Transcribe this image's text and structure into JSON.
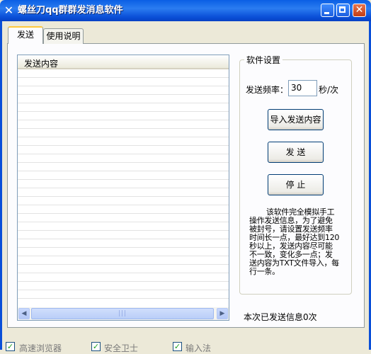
{
  "window": {
    "title": "螺丝刀qq群群发消息软件",
    "icon": "screwdriver-icon",
    "close_glyph": "✕"
  },
  "tabs": [
    {
      "label": "发送"
    },
    {
      "label": "使用说明"
    }
  ],
  "list": {
    "header": "发送内容"
  },
  "settings": {
    "group_title": "软件设置",
    "freq_label": "发送频率：",
    "freq_value": "30",
    "freq_unit": "秒/次",
    "import_label": "导入发送内容",
    "send_label": "发 送",
    "stop_label": "停 止",
    "notice": "该软件完全模拟手工操作发送信息，为了避免被封号，请设置发送频率时间长一点，最好达到120秒以上，发送内容尽可能不一致，变化多一点；发送内容为TXT文件导入，每行一条。"
  },
  "status": {
    "text": "本次已发送信息0次"
  },
  "bottom_options": [
    {
      "label": "高速浏览器",
      "checked": true
    },
    {
      "label": "安全卫士",
      "checked": true
    },
    {
      "label": "输入法",
      "checked": true
    }
  ],
  "colors": {
    "titlebar": "#0A5FE4",
    "tab_highlight": "#FFC83C",
    "window_bg": "#ECE9D8"
  }
}
